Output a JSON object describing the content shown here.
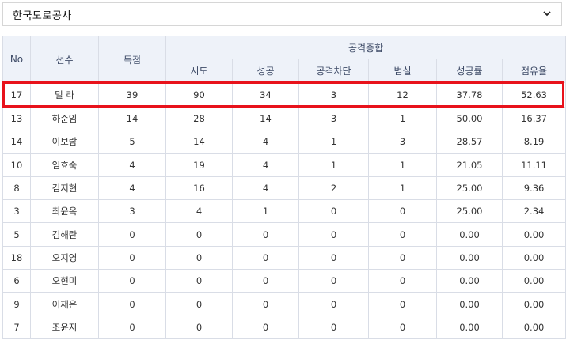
{
  "team_select": {
    "value": "한국도로공사"
  },
  "table": {
    "headers": {
      "no": "No",
      "player": "선수",
      "score": "득점",
      "group": "공격종합"
    },
    "subheaders": [
      "시도",
      "성공",
      "공격차단",
      "범실",
      "성공률",
      "점유율"
    ],
    "rows": [
      {
        "no": "17",
        "player": "밀 라",
        "score": "39",
        "attempts": "90",
        "success": "34",
        "blocked": "3",
        "errors": "12",
        "success_rate": "37.78",
        "share": "52.63"
      },
      {
        "no": "13",
        "player": "하준임",
        "score": "14",
        "attempts": "28",
        "success": "14",
        "blocked": "3",
        "errors": "1",
        "success_rate": "50.00",
        "share": "16.37"
      },
      {
        "no": "14",
        "player": "이보람",
        "score": "5",
        "attempts": "14",
        "success": "4",
        "blocked": "1",
        "errors": "3",
        "success_rate": "28.57",
        "share": "8.19"
      },
      {
        "no": "10",
        "player": "임효숙",
        "score": "4",
        "attempts": "19",
        "success": "4",
        "blocked": "1",
        "errors": "1",
        "success_rate": "21.05",
        "share": "11.11"
      },
      {
        "no": "8",
        "player": "김지현",
        "score": "4",
        "attempts": "16",
        "success": "4",
        "blocked": "2",
        "errors": "1",
        "success_rate": "25.00",
        "share": "9.36"
      },
      {
        "no": "3",
        "player": "최윤옥",
        "score": "3",
        "attempts": "4",
        "success": "1",
        "blocked": "0",
        "errors": "0",
        "success_rate": "25.00",
        "share": "2.34"
      },
      {
        "no": "5",
        "player": "김해란",
        "score": "0",
        "attempts": "0",
        "success": "0",
        "blocked": "0",
        "errors": "0",
        "success_rate": "0.00",
        "share": "0.00"
      },
      {
        "no": "18",
        "player": "오지영",
        "score": "0",
        "attempts": "0",
        "success": "0",
        "blocked": "0",
        "errors": "0",
        "success_rate": "0.00",
        "share": "0.00"
      },
      {
        "no": "6",
        "player": "오현미",
        "score": "0",
        "attempts": "0",
        "success": "0",
        "blocked": "0",
        "errors": "0",
        "success_rate": "0.00",
        "share": "0.00"
      },
      {
        "no": "9",
        "player": "이재은",
        "score": "0",
        "attempts": "0",
        "success": "0",
        "blocked": "0",
        "errors": "0",
        "success_rate": "0.00",
        "share": "0.00"
      },
      {
        "no": "7",
        "player": "조윤지",
        "score": "0",
        "attempts": "0",
        "success": "0",
        "blocked": "0",
        "errors": "0",
        "success_rate": "0.00",
        "share": "0.00"
      }
    ]
  },
  "colors": {
    "highlight": "#e8121b",
    "header_bg": "#eef2f9",
    "border": "#d9dde6"
  },
  "icons": {
    "dropdown": "chevron-down-icon"
  }
}
